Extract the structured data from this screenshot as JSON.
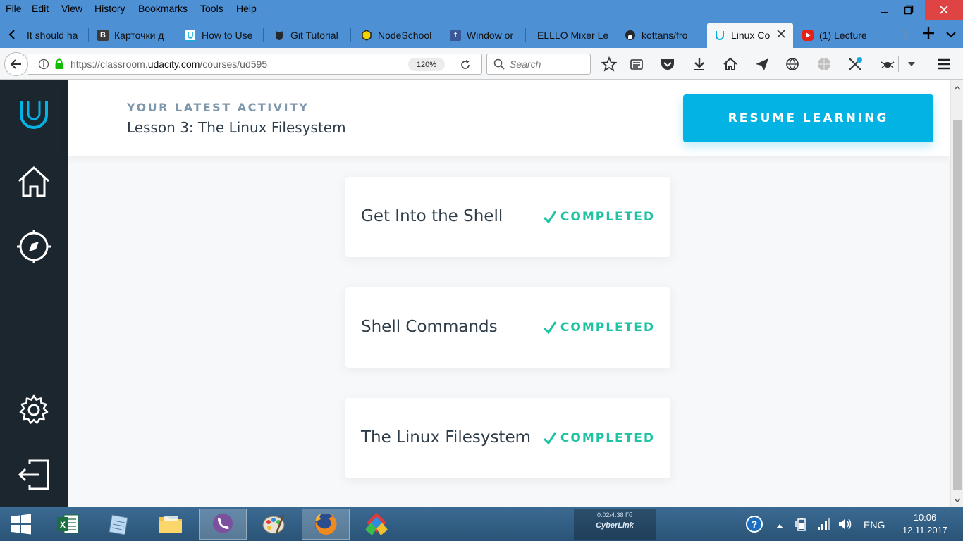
{
  "menubar": {
    "items": [
      "File",
      "Edit",
      "View",
      "History",
      "Bookmarks",
      "Tools",
      "Help"
    ],
    "underline": [
      "F",
      "E",
      "V",
      "s",
      "B",
      "T",
      "H"
    ]
  },
  "tabs": [
    {
      "title": "It should ha",
      "favicon": "blank"
    },
    {
      "title": "Карточки д",
      "favicon": "vk-b",
      "fav_color": "#3b3b3b"
    },
    {
      "title": "How to Use",
      "favicon": "udacity",
      "fav_color": "#02b3e4"
    },
    {
      "title": "Git Tutorial",
      "favicon": "github-cat",
      "fav_color": "#24292e"
    },
    {
      "title": "NodeSchool",
      "favicon": "hexagon",
      "fav_color": "#f2d500"
    },
    {
      "title": "Window or",
      "favicon": "facebook",
      "fav_color": "#3b5998"
    },
    {
      "title": "ELLLO Mixer Le",
      "favicon": "blank"
    },
    {
      "title": "kottans/fro",
      "favicon": "github",
      "fav_color": "#24292e"
    },
    {
      "title": "Linux Co",
      "favicon": "udacity",
      "fav_color": "#02b3e4",
      "active": true
    },
    {
      "title": "(1) Lecture",
      "favicon": "youtube",
      "fav_color": "#e62117"
    }
  ],
  "navbar": {
    "url_prefix": "https://classroom.",
    "url_domain": "udacity.com",
    "url_path": "/courses/ud595",
    "zoom": "120%",
    "search_placeholder": "Search"
  },
  "page": {
    "activity_label": "YOUR LATEST ACTIVITY",
    "activity_title": "Lesson 3: The Linux Filesystem",
    "resume_label": "RESUME LEARNING",
    "lessons": [
      {
        "title": "Get Into the Shell",
        "status": "COMPLETED"
      },
      {
        "title": "Shell Commands",
        "status": "COMPLETED"
      },
      {
        "title": "The Linux Filesystem",
        "status": "COMPLETED"
      }
    ]
  },
  "taskbar": {
    "cyberlink_stat": "0.02/4.38 Гб",
    "cyberlink_brand": "CyberLink",
    "language": "ENG",
    "time": "10:06",
    "date": "12.11.2017"
  },
  "colors": {
    "accent": "#02b3e4",
    "sidebar": "#1c262f",
    "completed": "#1fc3a3",
    "titlebar": "#4d90d4"
  }
}
